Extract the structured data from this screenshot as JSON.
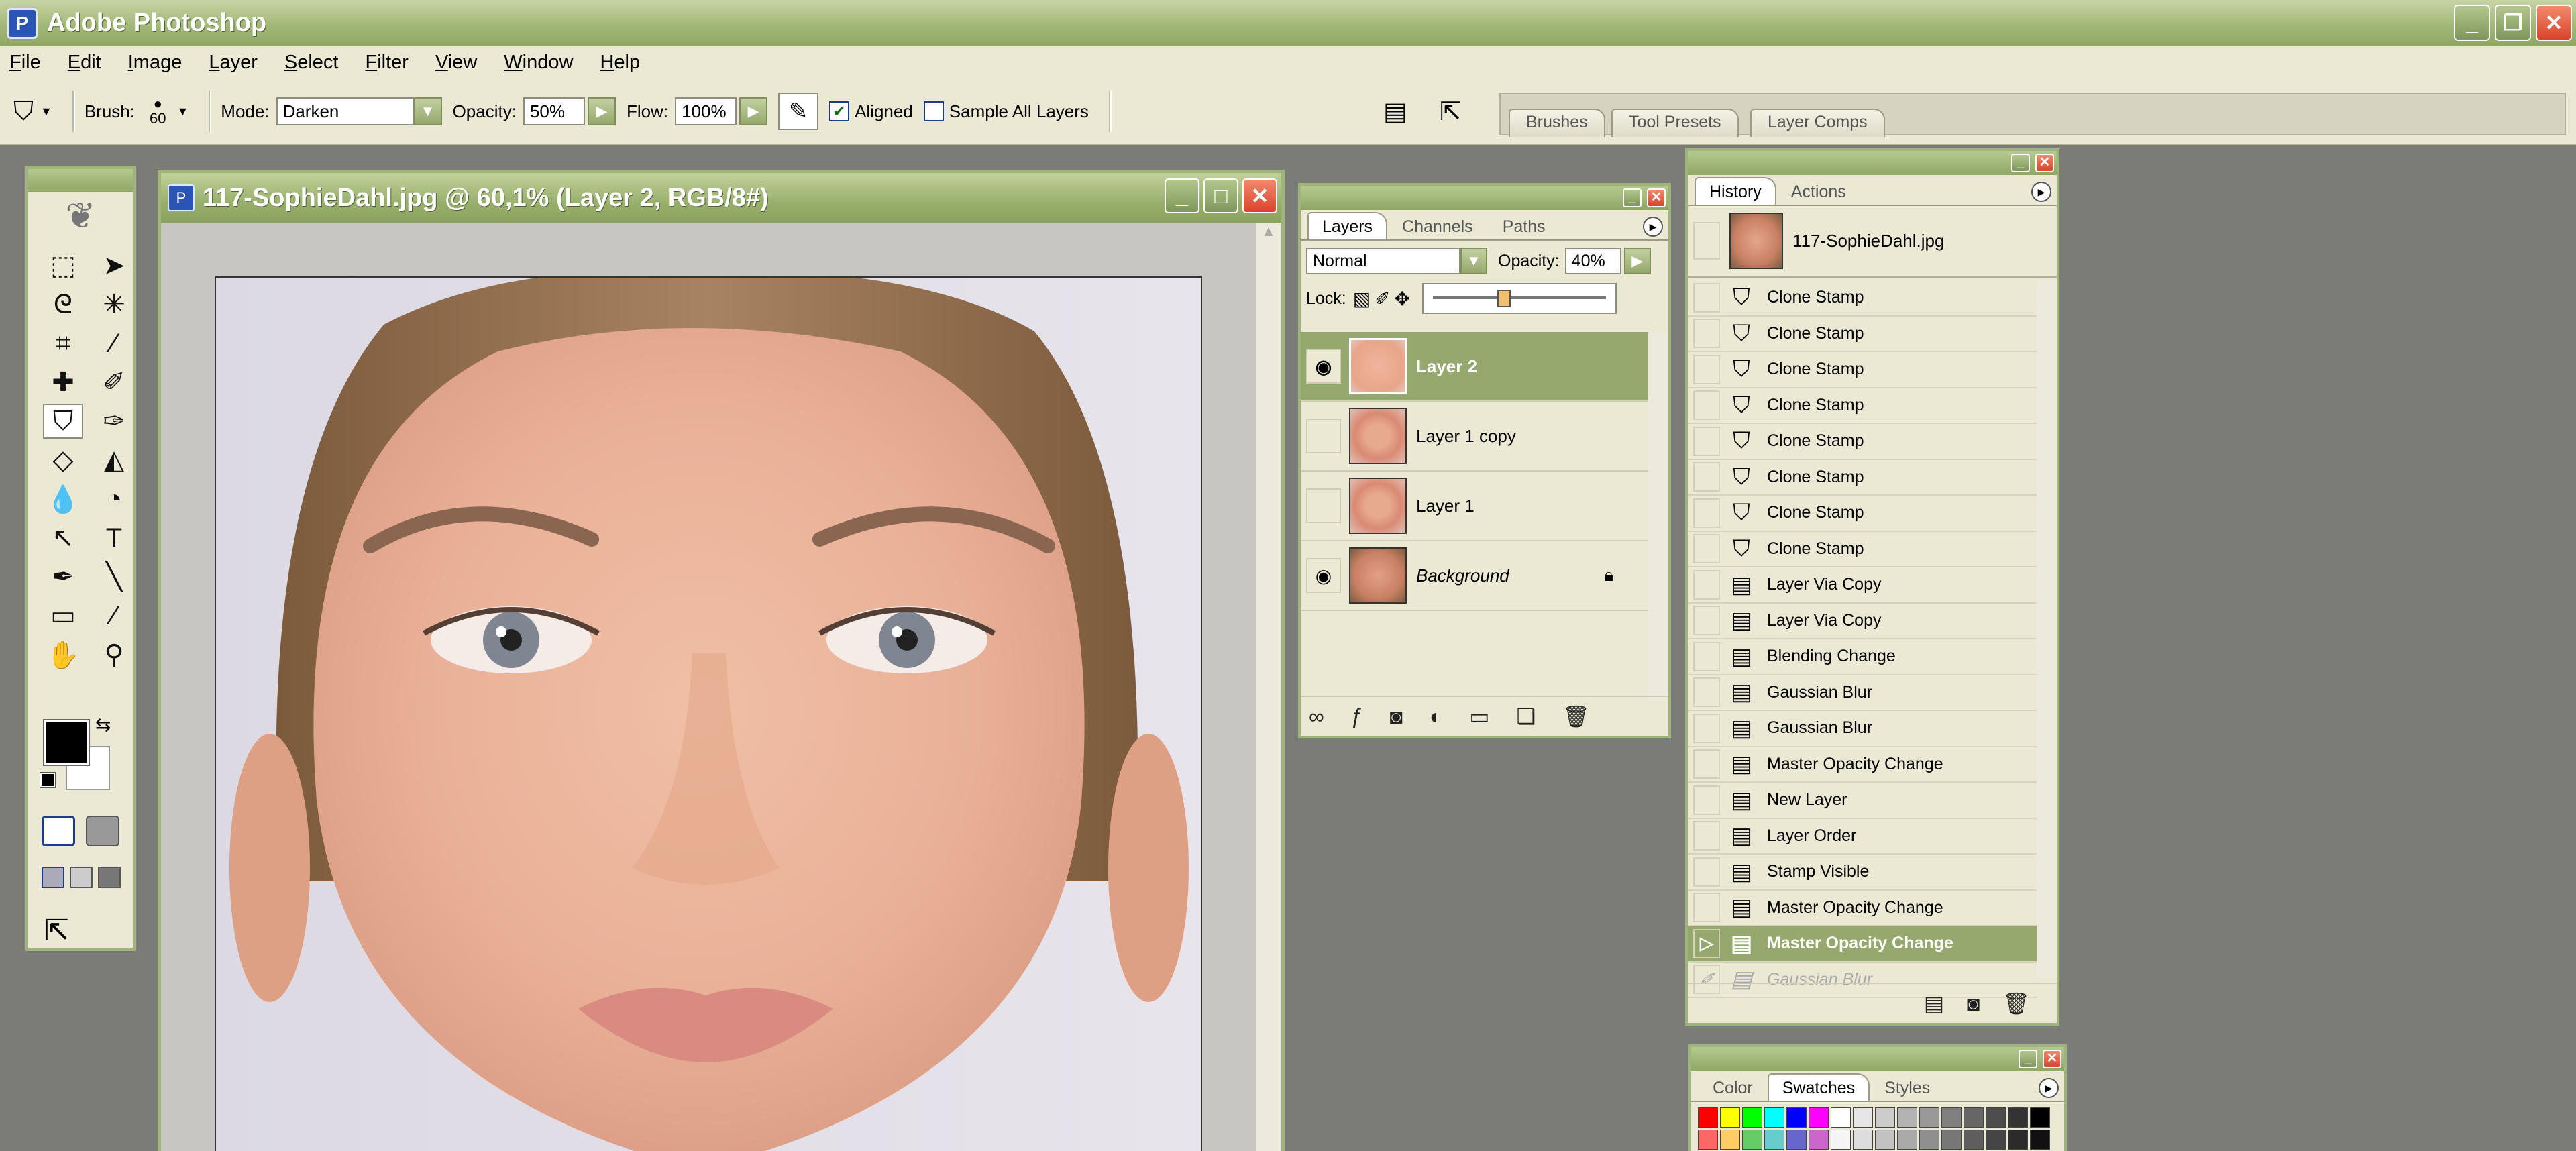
{
  "app": {
    "title": "Adobe Photoshop",
    "icon": "photoshop-icon"
  },
  "window_buttons": [
    "minimize-icon",
    "restore-icon",
    "close-icon"
  ],
  "menu": [
    "File",
    "Edit",
    "Image",
    "Layer",
    "Select",
    "Filter",
    "View",
    "Window",
    "Help"
  ],
  "options": {
    "brush_label": "Brush:",
    "brush_size": "60",
    "mode_label": "Mode:",
    "mode_value": "Darken",
    "opacity_label": "Opacity:",
    "opacity_value": "50%",
    "flow_label": "Flow:",
    "flow_value": "100%",
    "aligned_label": "Aligned",
    "aligned_checked": true,
    "sample_all_label": "Sample All Layers",
    "sample_all_checked": false
  },
  "palette_well": {
    "tabs": [
      "Brushes",
      "Tool Presets",
      "Layer Comps"
    ]
  },
  "toolbox": {
    "tools": [
      "rectangular-marquee-icon",
      "move-icon",
      "lasso-icon",
      "magic-wand-icon",
      "crop-icon",
      "slice-icon",
      "healing-brush-icon",
      "brush-icon",
      "clone-stamp-icon",
      "history-brush-icon",
      "eraser-icon",
      "paint-bucket-icon",
      "blur-icon",
      "dodge-icon",
      "path-selection-icon",
      "type-icon",
      "pen-icon",
      "line-icon",
      "notes-icon",
      "eyedropper-icon",
      "hand-icon",
      "zoom-icon"
    ],
    "active_tool": "clone-stamp-icon",
    "foreground_color": "#000000",
    "background_color": "#ffffff"
  },
  "document": {
    "title": "117-SophieDahl.jpg @ 60,1% (Layer 2, RGB/8#)"
  },
  "layers_panel": {
    "tabs": [
      "Layers",
      "Channels",
      "Paths"
    ],
    "active_tab": "Layers",
    "blend_mode": "Normal",
    "opacity_label": "Opacity:",
    "opacity_value": "40%",
    "opacity_slider": 0.4,
    "lock_label": "Lock:",
    "layers": [
      {
        "name": "Layer 2",
        "visible": true,
        "selected": true
      },
      {
        "name": "Layer 1 copy",
        "visible": false,
        "selected": false
      },
      {
        "name": "Layer 1",
        "visible": false,
        "selected": false
      },
      {
        "name": "Background",
        "visible": true,
        "selected": false,
        "locked": true
      }
    ]
  },
  "history_panel": {
    "tabs": [
      "History",
      "Actions"
    ],
    "active_tab": "History",
    "snapshot": "117-SophieDahl.jpg",
    "items": [
      "Clone Stamp",
      "Clone Stamp",
      "Clone Stamp",
      "Clone Stamp",
      "Clone Stamp",
      "Clone Stamp",
      "Clone Stamp",
      "Clone Stamp",
      "Layer Via Copy",
      "Layer Via Copy",
      "Blending Change",
      "Gaussian Blur",
      "Gaussian Blur",
      "Master Opacity Change",
      "New Layer",
      "Layer Order",
      "Stamp Visible",
      "Master Opacity Change",
      "Master Opacity Change",
      "Gaussian Blur"
    ],
    "selected_index": 18,
    "undone_index": 19
  },
  "swatches_panel": {
    "tabs": [
      "Color",
      "Swatches",
      "Styles"
    ],
    "active_tab": "Swatches",
    "colors": [
      "#ff0000",
      "#ffff00",
      "#00ff00",
      "#00ffff",
      "#0000ff",
      "#ff00ff",
      "#ffffff",
      "#e6e6e6",
      "#cccccc",
      "#b3b3b3",
      "#999999",
      "#808080",
      "#666666",
      "#4d4d4d",
      "#333333",
      "#000000",
      "#ff6666",
      "#ffcc66",
      "#66cc66",
      "#66cccc",
      "#6666cc",
      "#cc66cc",
      "#f5f5f5",
      "#dddddd",
      "#c2c2c2",
      "#aaaaaa",
      "#8f8f8f",
      "#777777",
      "#5e5e5e",
      "#454545",
      "#2b2b2b",
      "#111111"
    ]
  }
}
